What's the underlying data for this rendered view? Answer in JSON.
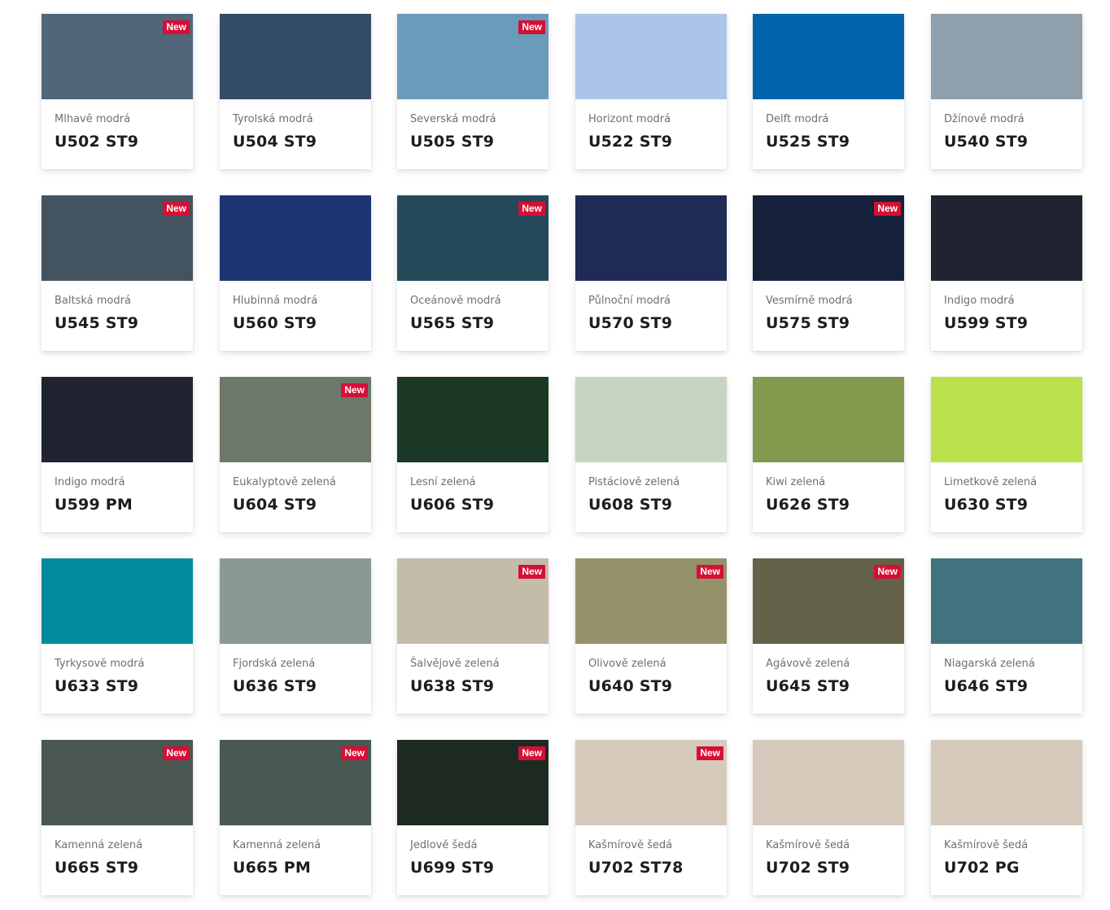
{
  "badge_label": "New",
  "decors": [
    {
      "name": "Mlhavě modrá",
      "code": "U502 ST9",
      "color": "#516679",
      "is_new": true
    },
    {
      "name": "Tyrolská modrá",
      "code": "U504 ST9",
      "color": "#344c65",
      "is_new": false
    },
    {
      "name": "Severská modrá",
      "code": "U505 ST9",
      "color": "#6a9bbb",
      "is_new": true
    },
    {
      "name": "Horizont modrá",
      "code": "U522 ST9",
      "color": "#abc5e9",
      "is_new": false
    },
    {
      "name": "Delft modrá",
      "code": "U525 ST9",
      "color": "#0163ac",
      "is_new": false
    },
    {
      "name": "Džínově modrá",
      "code": "U540 ST9",
      "color": "#8f9fab",
      "is_new": false
    },
    {
      "name": "Baltská modrá",
      "code": "U545 ST9",
      "color": "#435360",
      "is_new": true
    },
    {
      "name": "Hlubinná modrá",
      "code": "U560 ST9",
      "color": "#1e3574",
      "is_new": false
    },
    {
      "name": "Oceánově modrá",
      "code": "U565 ST9",
      "color": "#26495a",
      "is_new": true
    },
    {
      "name": "Půlnoční modrá",
      "code": "U570 ST9",
      "color": "#1f2a55",
      "is_new": false
    },
    {
      "name": "Vesmírně modrá",
      "code": "U575 ST9",
      "color": "#16223b",
      "is_new": true
    },
    {
      "name": "Indigo modrá",
      "code": "U599 ST9",
      "color": "#1f2430",
      "is_new": false
    },
    {
      "name": "Indigo modrá",
      "code": "U599 PM",
      "color": "#1f2430",
      "is_new": false
    },
    {
      "name": "Eukalyptově zelená",
      "code": "U604 ST9",
      "color": "#6d786b",
      "is_new": true
    },
    {
      "name": "Lesní zelená",
      "code": "U606 ST9",
      "color": "#1b3926",
      "is_new": false
    },
    {
      "name": "Pistáciově zelená",
      "code": "U608 ST9",
      "color": "#c9d3c1",
      "is_new": false
    },
    {
      "name": "Kiwi zelená",
      "code": "U626 ST9",
      "color": "#83994d",
      "is_new": false
    },
    {
      "name": "Limetkově zelená",
      "code": "U630 ST9",
      "color": "#bae04b",
      "is_new": false
    },
    {
      "name": "Tyrkysově modrá",
      "code": "U633 ST9",
      "color": "#008a9e",
      "is_new": false
    },
    {
      "name": "Fjordská zelená",
      "code": "U636 ST9",
      "color": "#8a9995",
      "is_new": false
    },
    {
      "name": "Šalvějově zelená",
      "code": "U638 ST9",
      "color": "#c2bca9",
      "is_new": true
    },
    {
      "name": "Olivově zelená",
      "code": "U640 ST9",
      "color": "#95926b",
      "is_new": true
    },
    {
      "name": "Agávově zelená",
      "code": "U645 ST9",
      "color": "#636248",
      "is_new": true
    },
    {
      "name": "Niagarská zelená",
      "code": "U646 ST9",
      "color": "#42727d",
      "is_new": false
    },
    {
      "name": "Kamenná zelená",
      "code": "U665 ST9",
      "color": "#4a5753",
      "is_new": true
    },
    {
      "name": "Kamenná zelená",
      "code": "U665 PM",
      "color": "#4a5853",
      "is_new": true
    },
    {
      "name": "Jedlově šedá",
      "code": "U699 ST9",
      "color": "#1c2a22",
      "is_new": true
    },
    {
      "name": "Kašmírově šedá",
      "code": "U702 ST78",
      "color": "#d6cabd",
      "is_new": true
    },
    {
      "name": "Kašmírově šedá",
      "code": "U702 ST9",
      "color": "#d6cabd",
      "is_new": false
    },
    {
      "name": "Kašmírově šedá",
      "code": "U702 PG",
      "color": "#d6cabd",
      "is_new": false
    }
  ]
}
